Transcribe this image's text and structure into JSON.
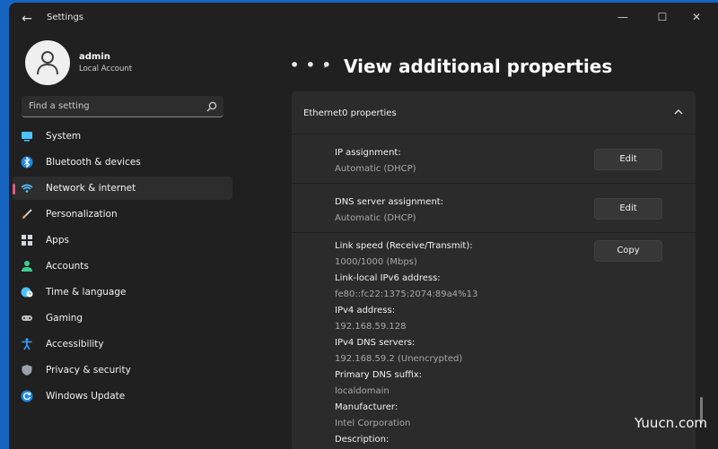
{
  "titlebar": {
    "app_title": "Settings",
    "back_glyph": "←",
    "minimize_glyph": "—",
    "maximize_glyph": "☐",
    "close_glyph": "✕"
  },
  "profile": {
    "name": "admin",
    "account_type": "Local Account"
  },
  "search": {
    "placeholder": "Find a setting"
  },
  "sidebar": {
    "items": [
      {
        "label": "System",
        "icon": "monitor-icon",
        "color": "#4cc2ff"
      },
      {
        "label": "Bluetooth & devices",
        "icon": "bluetooth-icon",
        "color": "#4cc2ff"
      },
      {
        "label": "Network & internet",
        "icon": "wifi-icon",
        "color": "#4cc2ff",
        "active": true
      },
      {
        "label": "Personalization",
        "icon": "brush-icon",
        "color": "#f7a35c"
      },
      {
        "label": "Apps",
        "icon": "apps-icon",
        "color": "#cfd8e0"
      },
      {
        "label": "Accounts",
        "icon": "person-icon",
        "color": "#3ecf8e"
      },
      {
        "label": "Time & language",
        "icon": "globe-clock-icon",
        "color": "#4cc2ff"
      },
      {
        "label": "Gaming",
        "icon": "gamepad-icon",
        "color": "#bdbdbd"
      },
      {
        "label": "Accessibility",
        "icon": "accessibility-icon",
        "color": "#3aa0ff"
      },
      {
        "label": "Privacy & security",
        "icon": "shield-icon",
        "color": "#9aa3ab"
      },
      {
        "label": "Windows Update",
        "icon": "update-icon",
        "color": "#3aa0ff"
      }
    ]
  },
  "breadcrumb": {
    "ellipsis": "• • •",
    "separator": "›",
    "title": "View additional properties"
  },
  "card": {
    "title": "Ethernet0 properties",
    "ip_assignment": {
      "label": "IP assignment:",
      "value": "Automatic (DHCP)",
      "button": "Edit"
    },
    "dns_assignment": {
      "label": "DNS server assignment:",
      "value": "Automatic (DHCP)",
      "button": "Edit"
    },
    "copy_button": "Copy",
    "properties": [
      {
        "label": "Link speed (Receive/Transmit):",
        "value": "1000/1000 (Mbps)"
      },
      {
        "label": "Link-local IPv6 address:",
        "value": "fe80::fc22:1375:2074:89a4%13"
      },
      {
        "label": "IPv4 address:",
        "value": "192.168.59.128"
      },
      {
        "label": "IPv4 DNS servers:",
        "value": "192.168.59.2 (Unencrypted)"
      },
      {
        "label": "Primary DNS suffix:",
        "value": "localdomain"
      },
      {
        "label": "Manufacturer:",
        "value": "Intel Corporation"
      },
      {
        "label": "Description:",
        "value": ""
      }
    ]
  },
  "watermark": "Yuucn.com",
  "colors": {
    "accent": "#4cc2ff",
    "active_indicator": "#e0598a",
    "desktop": "#1565c0"
  }
}
